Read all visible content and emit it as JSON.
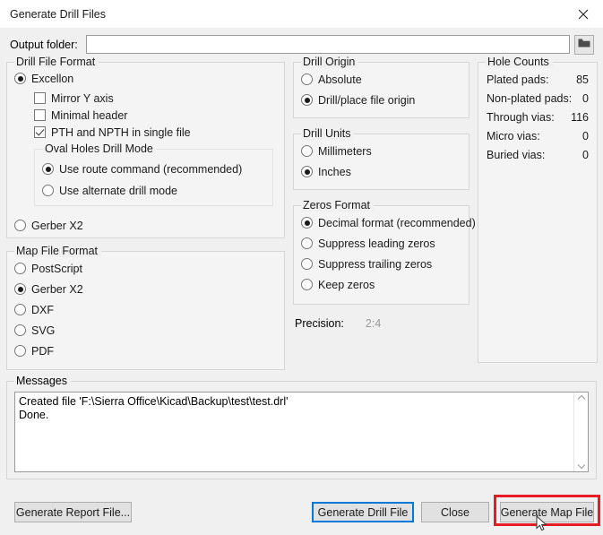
{
  "window": {
    "title": "Generate Drill Files",
    "close_icon": "close-icon"
  },
  "output_folder": {
    "label": "Output folder:",
    "value": "",
    "placeholder": "",
    "browse_icon": "folder-icon"
  },
  "drill_file_format": {
    "title": "Drill File Format",
    "excellon": {
      "label": "Excellon",
      "selected": true
    },
    "options": [
      {
        "label": "Mirror Y axis",
        "checked": false
      },
      {
        "label": "Minimal header",
        "checked": false
      },
      {
        "label": "PTH and NPTH in single file",
        "checked": true
      }
    ],
    "oval_holes": {
      "title": "Oval Holes Drill Mode",
      "options": [
        {
          "label": "Use route command (recommended)",
          "selected": true
        },
        {
          "label": "Use alternate drill mode",
          "selected": false
        }
      ]
    },
    "gerber_x2": {
      "label": "Gerber X2",
      "selected": false
    }
  },
  "map_file_format": {
    "title": "Map File Format",
    "options": [
      {
        "label": "PostScript",
        "selected": false
      },
      {
        "label": "Gerber X2",
        "selected": true
      },
      {
        "label": "DXF",
        "selected": false
      },
      {
        "label": "SVG",
        "selected": false
      },
      {
        "label": "PDF",
        "selected": false
      }
    ]
  },
  "drill_origin": {
    "title": "Drill Origin",
    "options": [
      {
        "label": "Absolute",
        "selected": false
      },
      {
        "label": "Drill/place file origin",
        "selected": true
      }
    ]
  },
  "drill_units": {
    "title": "Drill Units",
    "options": [
      {
        "label": "Millimeters",
        "selected": false
      },
      {
        "label": "Inches",
        "selected": true
      }
    ]
  },
  "zeros_format": {
    "title": "Zeros Format",
    "options": [
      {
        "label": "Decimal format (recommended)",
        "selected": true
      },
      {
        "label": "Suppress leading zeros",
        "selected": false
      },
      {
        "label": "Suppress trailing zeros",
        "selected": false
      },
      {
        "label": "Keep zeros",
        "selected": false
      }
    ]
  },
  "precision": {
    "label": "Precision:",
    "value": "2:4"
  },
  "hole_counts": {
    "title": "Hole Counts",
    "rows": [
      {
        "label": "Plated pads:",
        "value": "85"
      },
      {
        "label": "Non-plated pads:",
        "value": "0"
      },
      {
        "label": "Through vias:",
        "value": "116"
      },
      {
        "label": "Micro vias:",
        "value": "0"
      },
      {
        "label": "Buried vias:",
        "value": "0"
      }
    ]
  },
  "messages": {
    "title": "Messages",
    "text": "Created file 'F:\\Sierra Office\\Kicad\\Backup\\test\\test.drl'\nDone.",
    "scroll_up_icon": "chevron-up-icon",
    "scroll_down_icon": "chevron-down-icon"
  },
  "buttons": {
    "report": "Generate Report File...",
    "drill": "Generate Drill File",
    "close": "Close",
    "map": "Generate Map File"
  },
  "colors": {
    "accent": "#0078d7",
    "highlight": "#e51c23",
    "window_bg": "#f0f0f0",
    "group_bg": "#f4f4f4"
  }
}
